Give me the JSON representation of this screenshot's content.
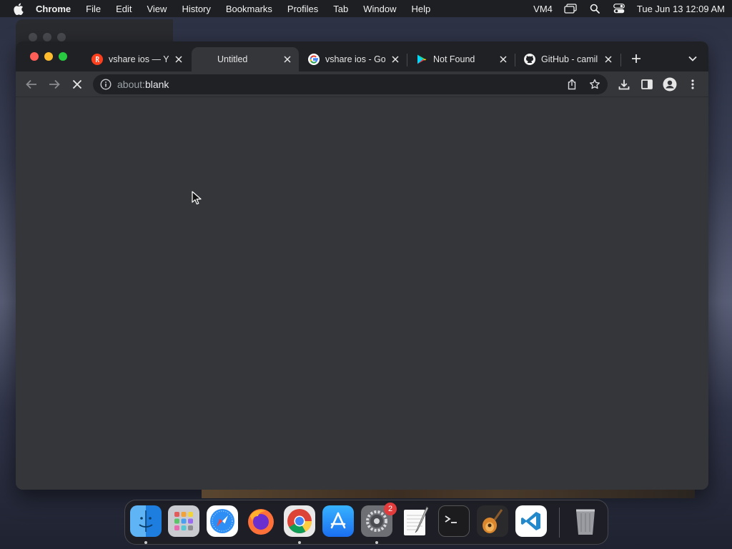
{
  "menubar": {
    "app_name": "Chrome",
    "items": [
      "File",
      "Edit",
      "View",
      "History",
      "Bookmarks",
      "Profiles",
      "Tab",
      "Window",
      "Help"
    ],
    "status_label": "VM4",
    "clock": "Tue Jun 13  12:09 AM"
  },
  "browser": {
    "tabs": [
      {
        "title": "vshare ios — Ya",
        "favicon": "yandex-icon",
        "active": false
      },
      {
        "title": "Untitled",
        "favicon": "blank-icon",
        "active": true
      },
      {
        "title": "vshare ios - Go",
        "favicon": "google-icon",
        "active": false
      },
      {
        "title": "Not Found",
        "favicon": "play-store-icon",
        "active": false
      },
      {
        "title": "GitHub - camil",
        "favicon": "github-icon",
        "active": false
      }
    ],
    "address": {
      "scheme": "about:",
      "path": "blank"
    },
    "loading": true
  },
  "dock": {
    "apps": [
      "Finder",
      "Launchpad",
      "Safari",
      "Firefox",
      "Chrome",
      "App Store",
      "System Settings",
      "TextEdit",
      "Terminal",
      "GarageBand",
      "VS Code",
      "Trash"
    ],
    "settings_badge": "2"
  },
  "colors": {
    "window_bg": "#35363a",
    "tabstrip_bg": "#202124",
    "close_red": "#ff5f57",
    "minimize_yellow": "#febc2e",
    "zoom_green": "#28c840"
  }
}
